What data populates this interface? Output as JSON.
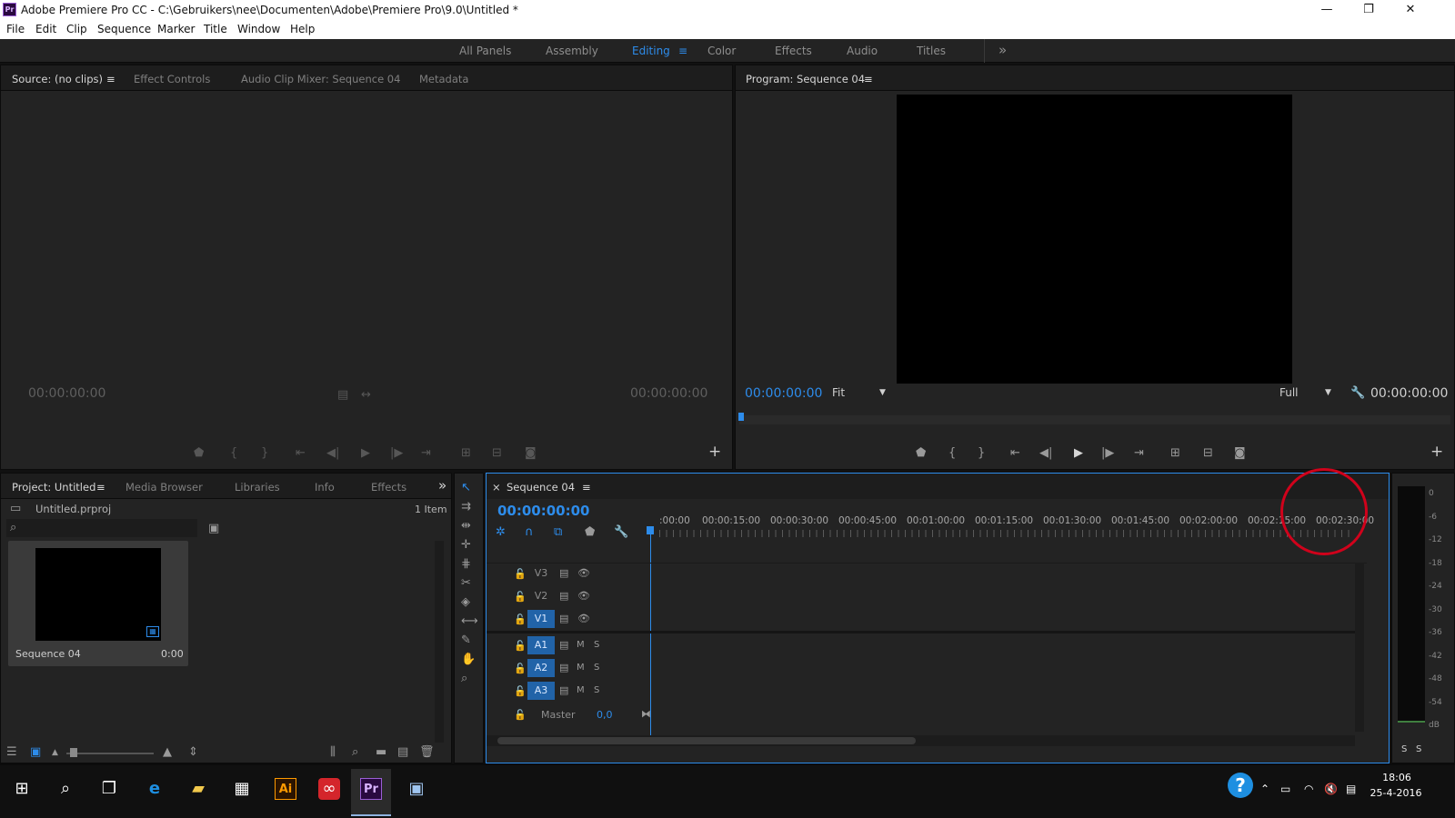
{
  "window": {
    "logo": "Pr",
    "title": "Adobe Premiere Pro CC - C:\\Gebruikers\\nee\\Documenten\\Adobe\\Premiere Pro\\9.0\\Untitled *",
    "minimize": "—",
    "maximize": "❐",
    "close": "✕"
  },
  "menu": [
    "File",
    "Edit",
    "Clip",
    "Sequence",
    "Marker",
    "Title",
    "Window",
    "Help"
  ],
  "workspaces": {
    "items": [
      "All Panels",
      "Assembly",
      "Editing",
      "Color",
      "Effects",
      "Audio",
      "Titles"
    ],
    "active": "Editing",
    "menu_glyph": "≡",
    "overflow": "»"
  },
  "source_panel": {
    "tabs": [
      "Source: (no clips)",
      "Effect Controls",
      "Audio Clip Mixer: Sequence 04",
      "Metadata"
    ],
    "tab_menu": "≡",
    "timecode_left": "00:00:00:00",
    "timecode_right": "00:00:00:00",
    "add": "+"
  },
  "program_panel": {
    "tab": "Program: Sequence 04",
    "tab_menu": "≡",
    "timecode_left": "00:00:00:00",
    "fit": "Fit",
    "quality": "Full",
    "timecode_right": "00:00:00:00",
    "add": "+"
  },
  "project_panel": {
    "tabs": [
      "Project: Untitled",
      "Media Browser",
      "Libraries",
      "Info",
      "Effects"
    ],
    "tab_menu": "≡",
    "overflow": "»",
    "file": "Untitled.prproj",
    "item_count": "1 Item",
    "clip_name": "Sequence 04",
    "clip_duration": "0:00"
  },
  "timeline": {
    "tab": "Sequence 04",
    "close": "×",
    "menu": "≡",
    "timecode": "00:00:00:00",
    "ruler": [
      ":00:00",
      "00:00:15:00",
      "00:00:30:00",
      "00:00:45:00",
      "00:01:00:00",
      "00:01:15:00",
      "00:01:30:00",
      "00:01:45:00",
      "00:02:00:00",
      "00:02:15:00",
      "00:02:30:00"
    ],
    "video_tracks": [
      "V3",
      "V2",
      "V1"
    ],
    "audio_tracks": [
      "A1",
      "A2",
      "A3"
    ],
    "track_m": "M",
    "track_s": "S",
    "master_label": "Master",
    "master_value": "0,0",
    "highlight_color": "#d0021b"
  },
  "audio_meter": {
    "scale": [
      "0",
      "-6",
      "-12",
      "-18",
      "-24",
      "-30",
      "-36",
      "-42",
      "-48",
      "-54",
      "dB"
    ],
    "solo": [
      "S",
      "S"
    ]
  },
  "taskbar": {
    "time": "18:06",
    "date": "25-4-2016",
    "help": "?"
  },
  "colors": {
    "accent": "#2d8ceb",
    "panel": "#232323",
    "annotation": "#d0021b"
  }
}
